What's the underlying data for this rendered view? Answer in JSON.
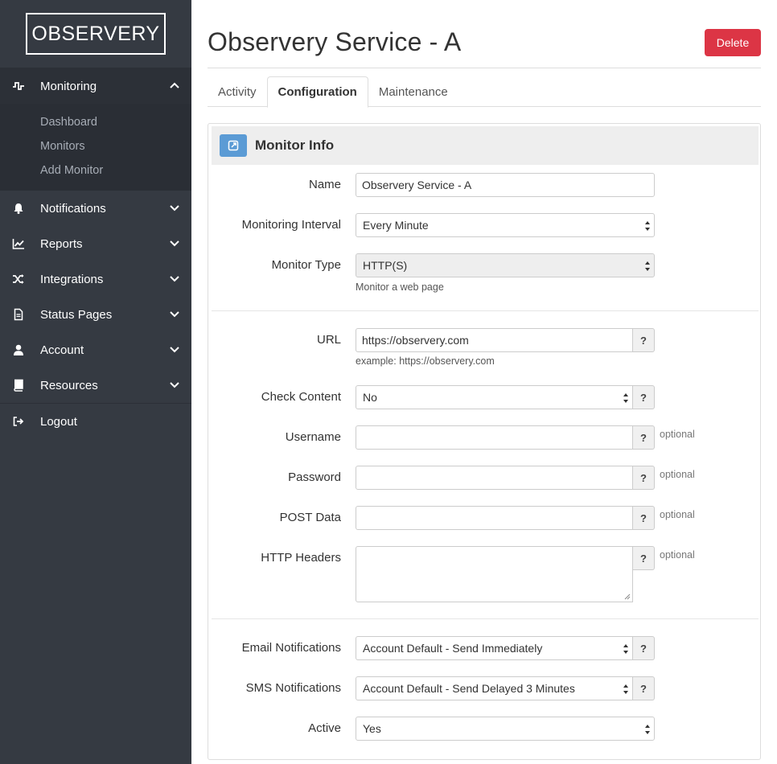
{
  "logo": "OBSERVERY",
  "sidebar": {
    "monitoring": {
      "label": "Monitoring",
      "icon": "pulse-icon"
    },
    "submenu": [
      "Dashboard",
      "Monitors",
      "Add Monitor"
    ],
    "items": [
      {
        "label": "Notifications",
        "icon": "bell-icon"
      },
      {
        "label": "Reports",
        "icon": "chart-icon"
      },
      {
        "label": "Integrations",
        "icon": "shuffle-icon"
      },
      {
        "label": "Status Pages",
        "icon": "document-icon"
      },
      {
        "label": "Account",
        "icon": "user-icon"
      },
      {
        "label": "Resources",
        "icon": "book-icon"
      }
    ],
    "logout": {
      "label": "Logout",
      "icon": "sign-out-icon"
    }
  },
  "page": {
    "title": "Observery Service - A",
    "delete_label": "Delete"
  },
  "tabs": [
    "Activity",
    "Configuration",
    "Maintenance"
  ],
  "active_tab": "Configuration",
  "panel": {
    "title": "Monitor Info",
    "icon": "external-link-icon"
  },
  "form": {
    "name": {
      "label": "Name",
      "value": "Observery Service - A"
    },
    "interval": {
      "label": "Monitoring Interval",
      "value": "Every Minute"
    },
    "type": {
      "label": "Monitor Type",
      "value": "HTTP(S)",
      "hint": "Monitor a web page"
    },
    "url": {
      "label": "URL",
      "value": "https://observery.com",
      "hint": "example: https://observery.com"
    },
    "check_content": {
      "label": "Check Content",
      "value": "No"
    },
    "username": {
      "label": "Username",
      "value": "",
      "optional": "optional"
    },
    "password": {
      "label": "Password",
      "value": "",
      "optional": "optional"
    },
    "post_data": {
      "label": "POST Data",
      "value": "",
      "optional": "optional"
    },
    "http_headers": {
      "label": "HTTP Headers",
      "value": "",
      "optional": "optional"
    },
    "email_notifications": {
      "label": "Email Notifications",
      "value": "Account Default - Send Immediately"
    },
    "sms_notifications": {
      "label": "SMS Notifications",
      "value": "Account Default - Send Delayed 3 Minutes"
    },
    "active": {
      "label": "Active",
      "value": "Yes"
    },
    "help_label": "?"
  },
  "colors": {
    "sidebar_bg": "#353a42",
    "delete_red": "#dc3545",
    "panel_icon_blue": "#5b9bd5"
  }
}
